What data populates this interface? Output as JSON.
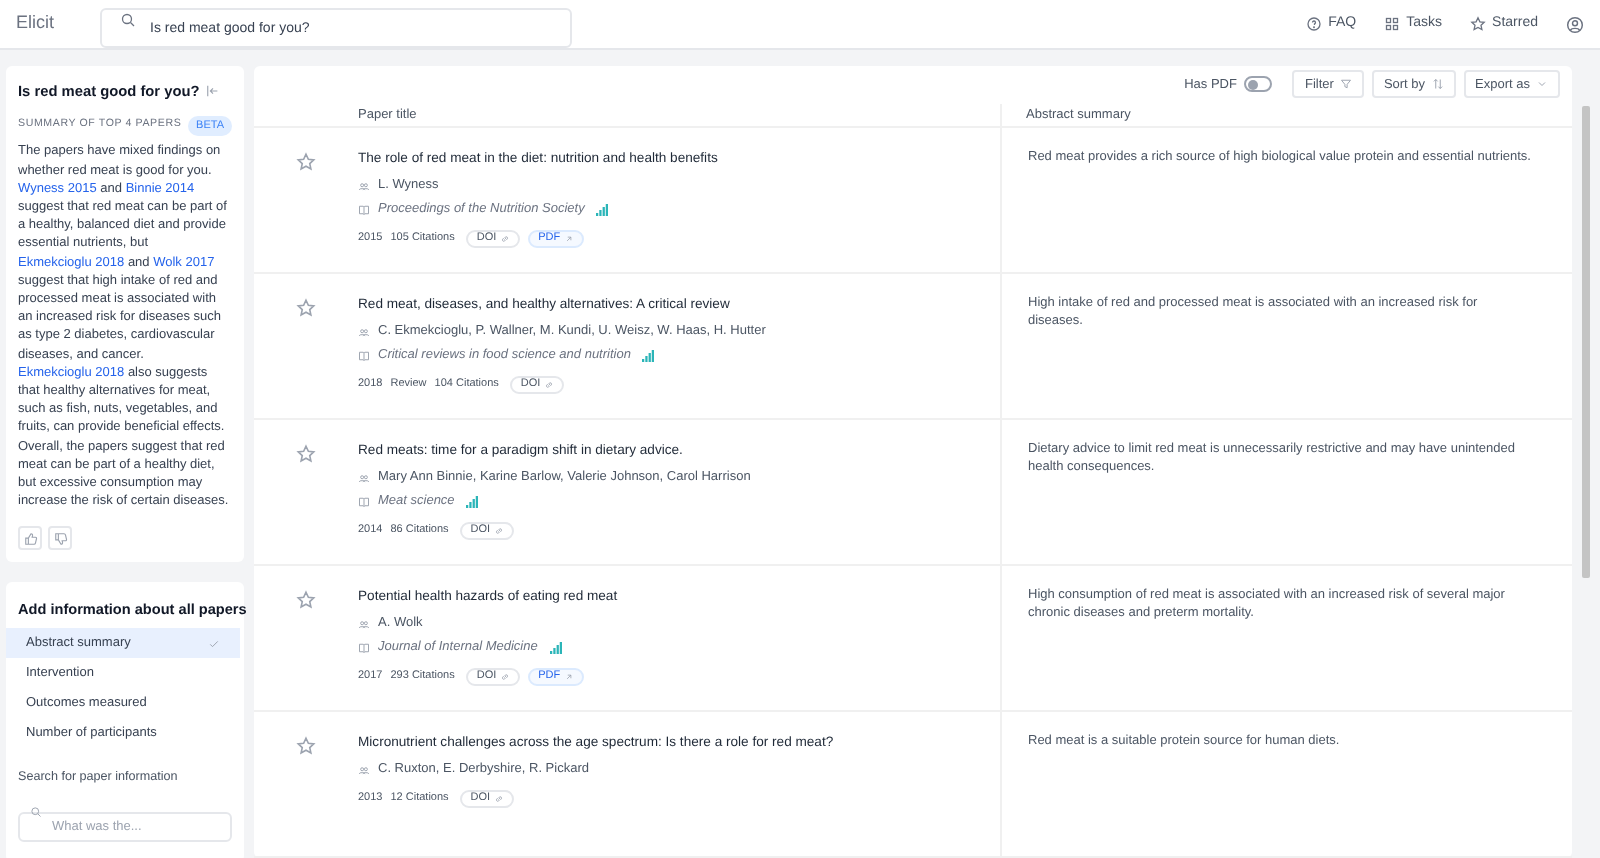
{
  "app": {
    "logo": "Elicit",
    "search_value": "Is red meat good for you?",
    "nav": [
      {
        "label": "FAQ",
        "kind": "faq"
      },
      {
        "label": "Tasks",
        "kind": "tasks"
      },
      {
        "label": "Starred",
        "kind": "starred"
      }
    ]
  },
  "summary": {
    "question": "Is red meat good for you?",
    "label": "SUMMARY OF TOP 4 PAPERS",
    "badge": "BETA",
    "segments": [
      {
        "text": "The papers have mixed findings on whether red meat is good for you.",
        "link": false
      },
      {
        "text": "Wyness 2015",
        "link": true
      },
      {
        "text": "and",
        "link": false
      },
      {
        "text": "Binnie 2014",
        "link": true
      },
      {
        "text": "suggest that red meat can be part of a healthy, balanced diet and provide essential nutrients, but",
        "link": false
      },
      {
        "text": "Ekmekcioglu 2018",
        "link": true
      },
      {
        "text": "and",
        "link": false
      },
      {
        "text": "Wolk 2017",
        "link": true
      },
      {
        "text": "suggest that high intake of red and processed meat is associated with an increased risk for diseases such as type 2 diabetes, cardiovascular diseases, and cancer.",
        "link": false
      },
      {
        "text": "Ekmekcioglu 2018",
        "link": true
      },
      {
        "text": "also suggests that healthy alternatives for meat, such as fish, nuts, vegetables, and fruits, can provide beneficial effects. Overall, the papers suggest that red meat can be part of a healthy diet, but excessive consumption may increase the risk of certain diseases.",
        "link": false
      }
    ]
  },
  "add_info": {
    "title": "Add information about all papers",
    "options": [
      {
        "label": "Abstract summary",
        "selected": true
      },
      {
        "label": "Intervention",
        "selected": false
      },
      {
        "label": "Outcomes measured",
        "selected": false
      },
      {
        "label": "Number of participants",
        "selected": false
      }
    ],
    "search_label": "Search for paper information",
    "search_placeholder": "What was the..."
  },
  "toolbar": {
    "has_pdf_label": "Has PDF",
    "has_pdf_on": false,
    "buttons": [
      {
        "label": "Filter",
        "kind": "filter"
      },
      {
        "label": "Sort by",
        "kind": "sort"
      },
      {
        "label": "Export as",
        "kind": "export"
      }
    ]
  },
  "table": {
    "columns": [
      "Paper title",
      "Abstract summary"
    ],
    "rows": [
      {
        "starred": false,
        "title": "The role of red meat in the diet: nutrition and health benefits",
        "authors": "L. Wyness",
        "journal": "Proceedings of the Nutrition Society",
        "year": "2015",
        "citations": "105 Citations",
        "links": [
          {
            "label": "DOI",
            "kind": "doi"
          },
          {
            "label": "PDF",
            "kind": "pdf"
          }
        ],
        "summary": "Red meat provides a rich source of high biological value protein and essential nutrients."
      },
      {
        "starred": false,
        "title": "Red meat, diseases, and healthy alternatives: A critical review",
        "authors": "C. Ekmekcioglu, P. Wallner, M. Kundi, U. Weisz, W. Haas, H. Hutter",
        "journal": "Critical reviews in food science and nutrition",
        "year": "2018",
        "type": "Review",
        "citations": "104 Citations",
        "links": [
          {
            "label": "DOI",
            "kind": "doi"
          }
        ],
        "summary": "High intake of red and processed meat is associated with an increased risk for diseases."
      },
      {
        "starred": false,
        "title": "Red meats: time for a paradigm shift in dietary advice.",
        "authors": "Mary Ann Binnie, Karine Barlow, Valerie Johnson, Carol Harrison",
        "journal": "Meat science",
        "year": "2014",
        "citations": "86 Citations",
        "links": [
          {
            "label": "DOI",
            "kind": "doi"
          }
        ],
        "summary": "Dietary advice to limit red meat is unnecessarily restrictive and may have unintended health consequences."
      },
      {
        "starred": false,
        "title": "Potential health hazards of eating red meat",
        "authors": "A. Wolk",
        "journal": "Journal of Internal Medicine",
        "year": "2017",
        "citations": "293 Citations",
        "links": [
          {
            "label": "DOI",
            "kind": "doi"
          },
          {
            "label": "PDF",
            "kind": "pdf"
          }
        ],
        "summary": "High consumption of red meat is associated with an increased risk of several major chronic diseases and preterm mortality."
      },
      {
        "starred": false,
        "title": "Micronutrient challenges across the age spectrum: Is there a role for red meat?",
        "authors": "C. Ruxton, E. Derbyshire, R. Pickard",
        "year": "2013",
        "citations": "12 Citations",
        "links": [
          {
            "label": "DOI",
            "kind": "doi"
          }
        ],
        "summary": "Red meat is a suitable protein source for human diets."
      }
    ]
  }
}
